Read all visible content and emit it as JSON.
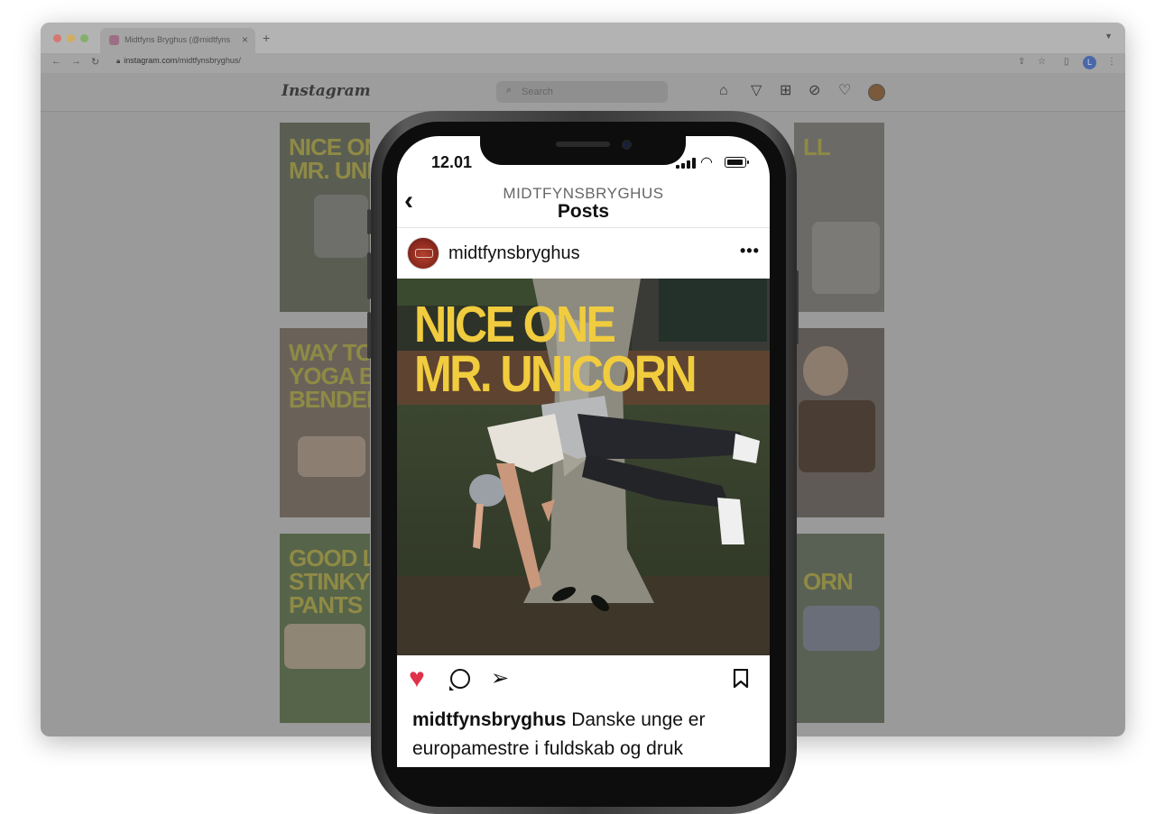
{
  "browser": {
    "tab_title": "Midtfyns Bryghus (@midtfyns...",
    "tab_close": "×",
    "new_tab": "+",
    "url_host": "instagram.com",
    "url_path": "/midtfynsbryghus/",
    "profile_initial": "L"
  },
  "instagram_web": {
    "logo": "Instagram",
    "search_placeholder": "Search",
    "tiles_left": [
      "NICE ONE\nMR. UNI",
      "WAY TO\nYOGA BE\nBENDER",
      "GOOD LO\nSTINKY\nPANTS"
    ],
    "tiles_right": [
      "LL",
      "",
      "ORN"
    ]
  },
  "phone": {
    "status_time": "12.01",
    "header_username": "MIDTFYNSBRYGHUS",
    "header_title": "Posts",
    "post_username": "midtfynsbryghus",
    "more_label": "•••",
    "headline": "NICE ONE\nMR. UNICORN",
    "caption_user": "midtfynsbryghus",
    "caption_text": " Danske unge er europamestre i fuldskab og druk"
  },
  "icons": {
    "back": "chevron-left-icon",
    "like": "heart-icon",
    "comment": "comment-icon",
    "share": "send-icon",
    "save": "bookmark-icon"
  },
  "colors": {
    "headline_yellow": "#f0cc3e",
    "like_red": "#e0304a"
  }
}
